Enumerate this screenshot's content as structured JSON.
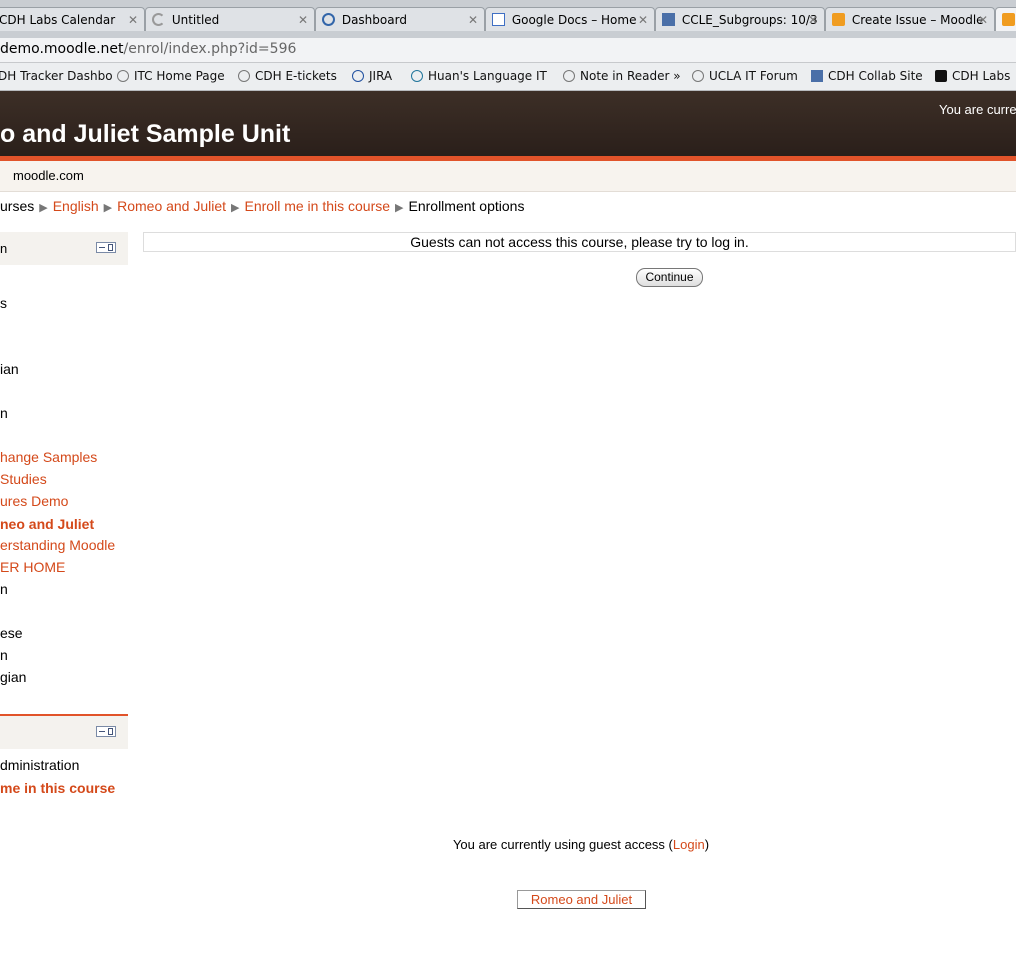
{
  "browser": {
    "tabs": [
      {
        "label": "CDH Labs Calendar",
        "icon": "calendar-icon"
      },
      {
        "label": "Untitled",
        "icon": "loading-icon"
      },
      {
        "label": "Dashboard",
        "icon": "jira-dashboard-icon"
      },
      {
        "label": "Google Docs – Home",
        "icon": "google-docs-icon"
      },
      {
        "label": "CCLE_Subgroups: 10/3",
        "icon": "ucla-icon"
      },
      {
        "label": "Create Issue – Moodle",
        "icon": "moodle-icon"
      }
    ],
    "url_host": "demo.moodle.net",
    "url_path": "/enrol/index.php?id=596",
    "bookmarks": [
      "DH Tracker Dashbo",
      "ITC Home Page",
      "CDH E-tickets",
      "JIRA",
      "Huan's Language IT",
      "Note in Reader »",
      "UCLA IT Forum",
      "CDH Collab Site",
      "CDH Labs"
    ]
  },
  "header": {
    "course_title": "o and Juliet Sample Unit",
    "login_info": "You are curre"
  },
  "navbar": {
    "site": "moodle.com"
  },
  "breadcrumb": {
    "items": [
      "urses",
      "English",
      "Romeo and Juliet",
      "Enroll me in this course"
    ],
    "current": "Enrollment options"
  },
  "sidebar": {
    "block1_title": "n",
    "items": [
      "s",
      "ian",
      "n",
      "hange Samples",
      "Studies",
      "ures Demo",
      "neo and Juliet",
      "erstanding Moodle",
      "ER HOME",
      "n",
      "ese",
      "n",
      "gian"
    ],
    "admin_items": [
      "dministration",
      "me in this course"
    ]
  },
  "main": {
    "notice": "Guests can not access this course, please try to log in.",
    "continue_label": "Continue"
  },
  "footer": {
    "guest_text": "You are currently using guest access (",
    "login_link": "Login",
    "guest_close": ")",
    "home_button": "Romeo and Juliet"
  },
  "colors": {
    "accent": "#e1532a",
    "link": "#d4491a",
    "header_bg": "#2f231d"
  }
}
